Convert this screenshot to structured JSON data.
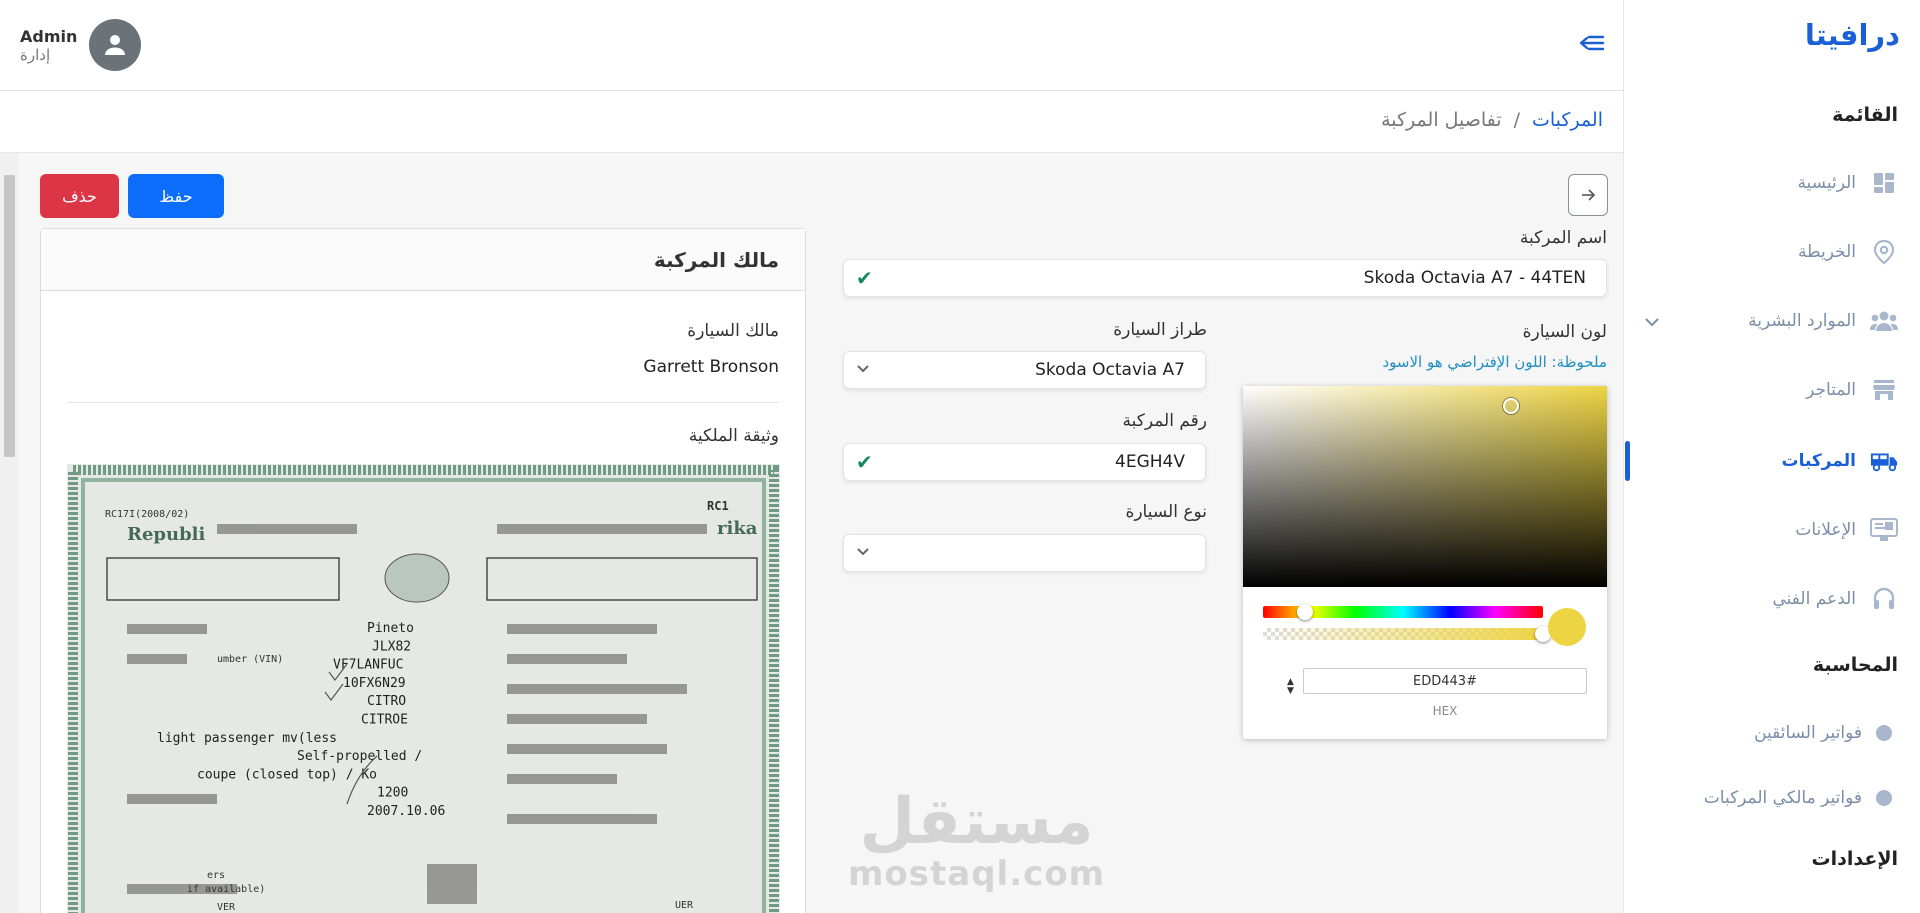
{
  "brand": "درافيتا",
  "sidebar": {
    "menu_title": "القائمة",
    "items": [
      {
        "label": "الرئيسية",
        "icon": "dashboard-icon"
      },
      {
        "label": "الخريطة",
        "icon": "map-pin-icon"
      },
      {
        "label": "الموارد البشرية",
        "icon": "users-icon"
      },
      {
        "label": "المتاجر",
        "icon": "store-icon"
      },
      {
        "label": "المركبات",
        "icon": "truck-icon"
      },
      {
        "label": "الإعلانات",
        "icon": "monitor-icon"
      },
      {
        "label": "الدعم الفني",
        "icon": "headset-icon"
      }
    ],
    "accounting_title": "المحاسبة",
    "accounting_items": [
      {
        "label": "فواتير السائقين"
      },
      {
        "label": "فواتير مالكي المركبات"
      }
    ],
    "settings_title": "الإعدادات"
  },
  "user": {
    "name": "Admin",
    "role": "إدارة"
  },
  "breadcrumb": {
    "parent": "المركبات",
    "separator": "/",
    "current": "تفاصيل المركبة"
  },
  "actions": {
    "save": "حفظ",
    "delete": "حذف"
  },
  "form": {
    "vehicle_name_label": "اسم المركبة",
    "vehicle_name_value": "Skoda Octavia A7 - 44TEN",
    "car_color_label": "لون السيارة",
    "color_note": "ملحوظة: اللون الإفتراضي هو الاسود",
    "car_model_label": "طراز السيارة",
    "car_model_value": "Skoda Octavia A7",
    "vehicle_number_label": "رقم المركبة",
    "vehicle_number_value": "4EGH4V",
    "car_type_label": "نوع السيارة",
    "car_type_value": ""
  },
  "color_picker": {
    "hex_value": "EDD443#",
    "hex_label": "HEX",
    "color": "#EDD443"
  },
  "owner_card": {
    "title": "مالك المركبة",
    "owner_label": "مالك السيارة",
    "owner_value": "Garrett Bronson",
    "document_label": "وثيقة الملكية"
  },
  "document_text": {
    "header_left": "RC17I(2008/02)",
    "header_right": "RC1",
    "republic": "Republi",
    "rika": "rika",
    "lines": [
      "Pineto",
      "JLX82",
      "VF7LANFUC",
      "10FX6N29",
      "CITRO",
      "CITROE",
      "light passenger mv(less",
      "Self-propelled /",
      "coupe (closed top) / Ko",
      "1200",
      "2007.10.06"
    ],
    "vin_label": "umber (VIN)",
    "available": "if available)",
    "ers": "ers",
    "uer": "UER",
    "ver": "VER"
  },
  "watermark": {
    "arabic": "مستقل",
    "english": "mostaql.com"
  },
  "colors": {
    "primary": "#1a5fd6",
    "save": "#0d6efd",
    "delete": "#dc3545",
    "check": "#198754",
    "note": "#1f8fc2"
  }
}
